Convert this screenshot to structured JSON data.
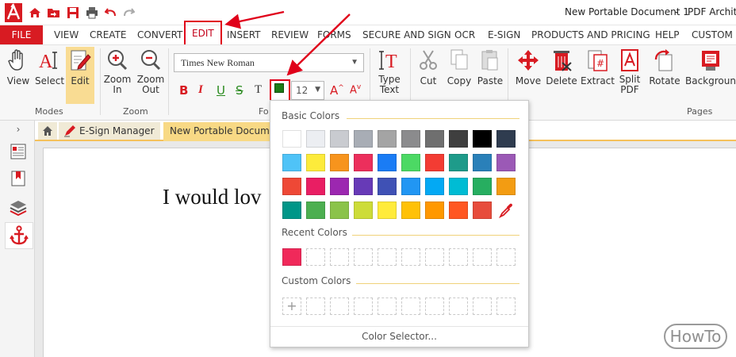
{
  "window": {
    "doc_title": "New Portable Document 1",
    "separator": "-",
    "brand": "PDF Architect"
  },
  "menu": {
    "file": "FILE",
    "items": [
      "VIEW",
      "CREATE",
      "CONVERT",
      "EDIT",
      "INSERT",
      "REVIEW",
      "FORMS",
      "SECURE AND SIGN",
      "OCR",
      "E-SIGN",
      "PRODUCTS AND PRICING",
      "HELP",
      "CUSTOM"
    ],
    "active": "EDIT"
  },
  "ribbon": {
    "modes": {
      "view": "View",
      "select": "Select",
      "edit": "Edit",
      "label": "Modes"
    },
    "zoom": {
      "zoom_in": [
        "Zoom",
        "In"
      ],
      "zoom_out": [
        "Zoom",
        "Out"
      ],
      "label": "Zoom"
    },
    "font": {
      "family": "Times New Roman",
      "size": "12",
      "label": "Fo",
      "bold": "B",
      "italic": "I",
      "underline": "U",
      "strike": "S",
      "textcolor_t": "T",
      "grow": "A",
      "shrink": "A",
      "current_color": "#1d7b16"
    },
    "type_text": [
      "Type",
      "Text"
    ],
    "clipboard": {
      "cut": "Cut",
      "copy": "Copy",
      "paste": "Paste"
    },
    "pages": {
      "move": "Move",
      "delete": "Delete",
      "extract": "Extract",
      "split": [
        "Split",
        "PDF"
      ],
      "rotate": "Rotate",
      "background": "Background",
      "label": "Pages"
    }
  },
  "tabs": {
    "esign": "E-Sign Manager",
    "doc": "New Portable Documen"
  },
  "document": {
    "text": "I would lov"
  },
  "color_popup": {
    "basic_title": "Basic Colors",
    "recent_title": "Recent Colors",
    "custom_title": "Custom Colors",
    "selector": "Color Selector...",
    "custom_add": "+",
    "basic_colors": [
      [
        "#ffffff",
        "#eceef2",
        "#c9cbd0",
        "#a8adb5",
        "#a4a4a4",
        "#8b8b8d",
        "#6f6f6f",
        "#3f3f3f",
        "#000000",
        "#2f3c4f"
      ],
      [
        "#4fc3f7",
        "#fdeb3b",
        "#f7941d",
        "#ec2f5c",
        "#1a7cf5",
        "#4cd964",
        "#f33c33",
        "#1e9b8a",
        "#2a80b9",
        "#9b59b6"
      ],
      [
        "#ee4836",
        "#e91e63",
        "#9c27b0",
        "#673ab7",
        "#3f51b5",
        "#2196f3",
        "#03a9f4",
        "#00bcd4",
        "#27ae60",
        "#f39c12"
      ],
      [
        "#009688",
        "#4caf50",
        "#8bc34a",
        "#cddc39",
        "#ffeb3b",
        "#ffc107",
        "#ff9800",
        "#ff5722",
        "#e74c3c"
      ]
    ],
    "recent_colors": [
      "#f0295a"
    ]
  },
  "watermark": "HowTo",
  "accent": {
    "red": "#d81b22",
    "gold": "#f5c15b"
  }
}
